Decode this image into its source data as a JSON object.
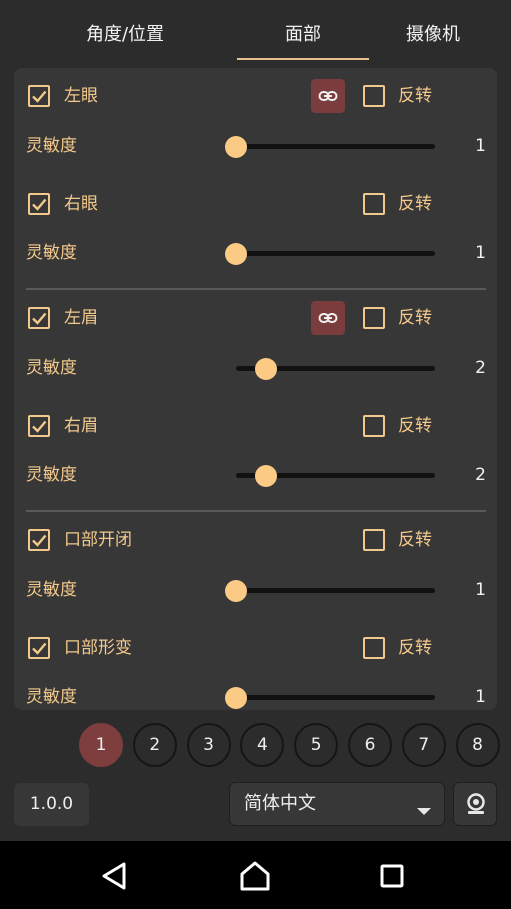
{
  "tabs": [
    {
      "label": "角度/位置"
    },
    {
      "label": "面部"
    },
    {
      "label": "摄像机"
    }
  ],
  "active_tab": "面部",
  "colors": {
    "accent": "#f3c98b",
    "slider_thumb": "#fbcb86",
    "link_button": "#7a3c3c",
    "active_page": "#7e3e3e",
    "background": "#2c2c2c",
    "panel": "#373737"
  },
  "groups": [
    {
      "controls": [
        {
          "label": "左眼",
          "checked": true,
          "invert_label": "反转",
          "invert_checked": false,
          "linked": true,
          "link_icon": "link-icon",
          "sensitivity_label": "灵敏度",
          "sensitivity": "1",
          "slider_fraction": 0.0
        },
        {
          "label": "右眼",
          "checked": true,
          "invert_label": "反转",
          "invert_checked": false,
          "linked": false,
          "sensitivity_label": "灵敏度",
          "sensitivity": "1",
          "slider_fraction": 0.0
        }
      ]
    },
    {
      "controls": [
        {
          "label": "左眉",
          "checked": true,
          "invert_label": "反转",
          "invert_checked": false,
          "linked": true,
          "link_icon": "link-icon",
          "sensitivity_label": "灵敏度",
          "sensitivity": "2",
          "slider_fraction": 0.15
        },
        {
          "label": "右眉",
          "checked": true,
          "invert_label": "反转",
          "invert_checked": false,
          "linked": false,
          "sensitivity_label": "灵敏度",
          "sensitivity": "2",
          "slider_fraction": 0.15
        }
      ]
    },
    {
      "controls": [
        {
          "label": "口部开闭",
          "checked": true,
          "invert_label": "反转",
          "invert_checked": false,
          "linked": false,
          "sensitivity_label": "灵敏度",
          "sensitivity": "1",
          "slider_fraction": 0.0
        },
        {
          "label": "口部形变",
          "checked": true,
          "invert_label": "反转",
          "invert_checked": false,
          "linked": false,
          "sensitivity_label": "灵敏度",
          "sensitivity": "1",
          "slider_fraction": 0.0
        }
      ]
    }
  ],
  "pages": [
    "1",
    "2",
    "3",
    "4",
    "5",
    "6",
    "7",
    "8"
  ],
  "active_page": "1",
  "footer": {
    "version": "1.0.0",
    "language": "简体中文",
    "language_caret_icon": "caret-down-icon",
    "camera_icon": "webcam-icon"
  },
  "navbar": {
    "back_icon": "back-triangle-icon",
    "home_icon": "home-icon",
    "recents_icon": "recents-square-icon"
  }
}
